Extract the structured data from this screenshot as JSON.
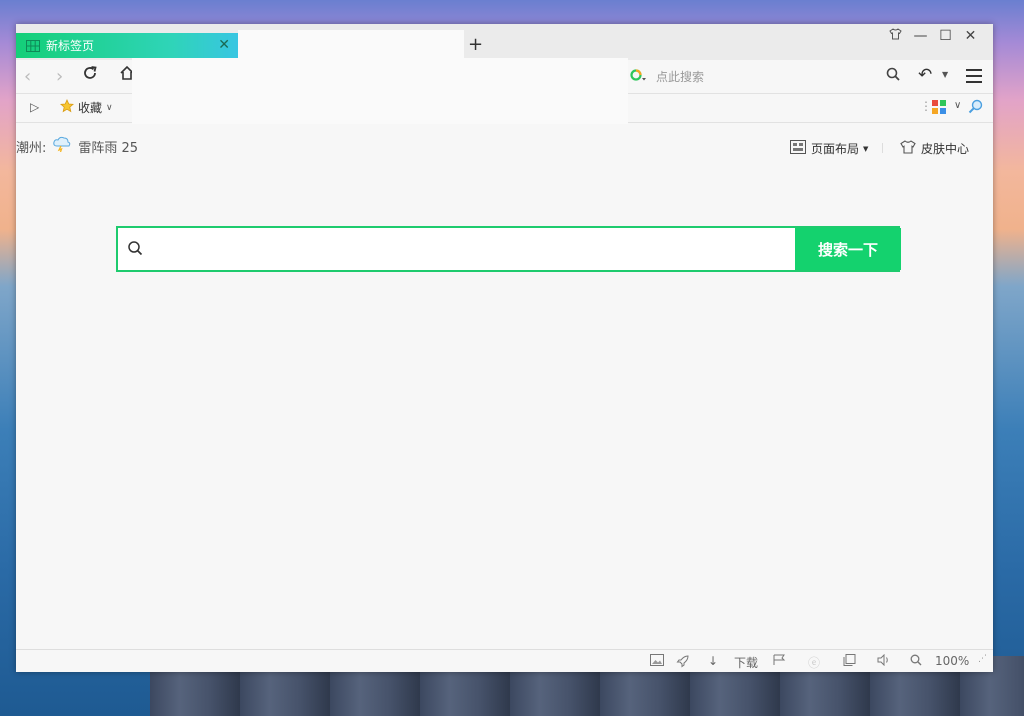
{
  "tabs": [
    {
      "title": "新标签页",
      "active": true
    }
  ],
  "toolbar": {
    "new_tab_label": "+",
    "search_placeholder": "点此搜索"
  },
  "favorites": {
    "label": "收藏"
  },
  "weather": {
    "city": "潮州:",
    "condition": "雷阵雨 25"
  },
  "page_tools": {
    "layout_label": "页面布局",
    "skin_label": "皮肤中心"
  },
  "search": {
    "button_label": "搜索一下",
    "value": ""
  },
  "statusbar": {
    "download_label": "下载",
    "zoom": "100%"
  },
  "colors": {
    "accent": "#14d26e",
    "tab_gradient_start": "#14cf78",
    "tab_gradient_end": "#38c6e2"
  }
}
